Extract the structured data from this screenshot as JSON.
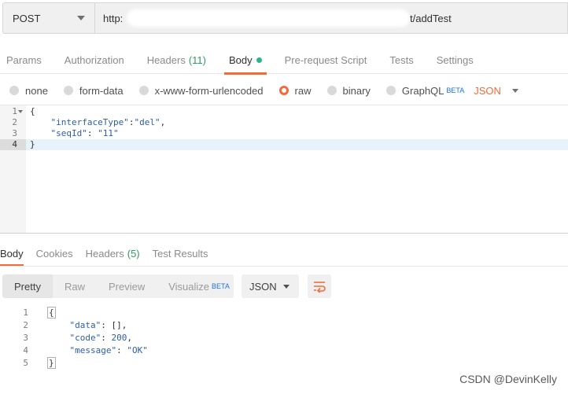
{
  "request": {
    "method": "POST",
    "url_head": "http:",
    "url_tail": "t/addTest"
  },
  "request_tabs": [
    {
      "label": "Params"
    },
    {
      "label": "Authorization"
    },
    {
      "label": "Headers",
      "count": "(11)"
    },
    {
      "label": "Body"
    },
    {
      "label": "Pre-request Script"
    },
    {
      "label": "Tests"
    },
    {
      "label": "Settings"
    }
  ],
  "body_types": [
    {
      "label": "none"
    },
    {
      "label": "form-data"
    },
    {
      "label": "x-www-form-urlencoded"
    },
    {
      "label": "raw"
    },
    {
      "label": "binary"
    },
    {
      "label": "GraphQL",
      "badge": "BETA"
    }
  ],
  "body_format": "JSON",
  "request_body_lines": [
    {
      "n": "1",
      "text": "{"
    },
    {
      "n": "2",
      "key": "\"interfaceType\"",
      "sep": ":",
      "val": "\"del\"",
      "end": ","
    },
    {
      "n": "3",
      "key": "\"seqId\"",
      "sep": ": ",
      "val": "\"11\"",
      "end": ""
    },
    {
      "n": "4",
      "text": "}"
    }
  ],
  "response_tabs": [
    {
      "label": "Body"
    },
    {
      "label": "Cookies"
    },
    {
      "label": "Headers",
      "count": "(5)"
    },
    {
      "label": "Test Results"
    }
  ],
  "response_views": [
    {
      "label": "Pretty"
    },
    {
      "label": "Raw"
    },
    {
      "label": "Preview"
    },
    {
      "label": "Visualize",
      "badge": "BETA"
    }
  ],
  "response_format": "JSON",
  "response_body_lines": [
    {
      "n": "1",
      "text": "{"
    },
    {
      "n": "2",
      "key": "\"data\"",
      "sep": ": ",
      "val": "[]",
      "end": ","
    },
    {
      "n": "3",
      "key": "\"code\"",
      "sep": ": ",
      "val": "200",
      "end": ","
    },
    {
      "n": "4",
      "key": "\"message\"",
      "sep": ": ",
      "val": "\"OK\"",
      "end": ""
    },
    {
      "n": "5",
      "text": "}"
    }
  ],
  "watermark": "CSDN @DevinKelly",
  "colors": {
    "accent": "#f26b3a",
    "count_green": "#2f9c62",
    "beta_blue": "#1a73e8",
    "body_dot": "#2db48c"
  },
  "icons": [
    "method-dropdown-caret",
    "format-dropdown-caret",
    "wrap-lines-icon"
  ]
}
